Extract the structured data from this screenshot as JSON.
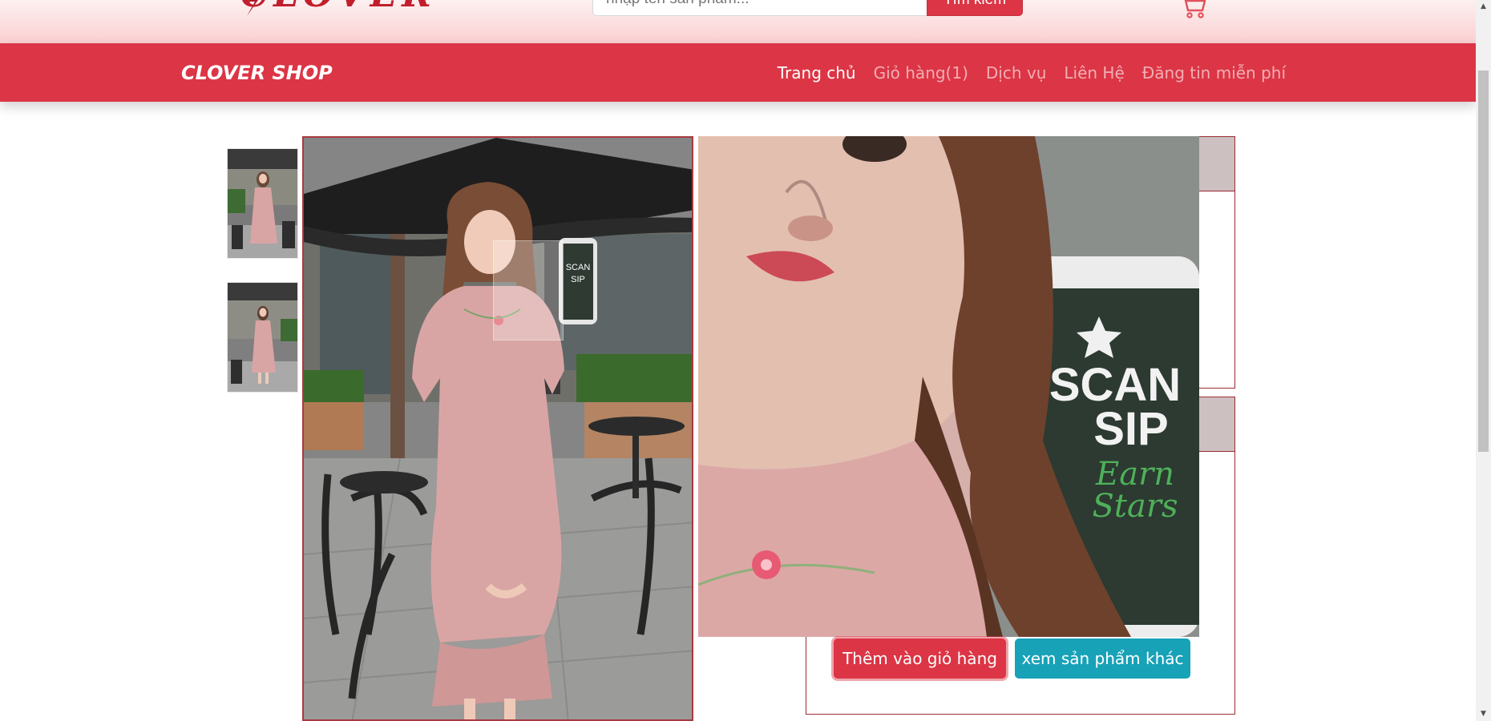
{
  "header": {
    "logo_text": "CLOVER",
    "search": {
      "placeholder": "nhập tên sản phẩm...",
      "button_label": "Tìm kiếm"
    },
    "cart_icon": "shopping-cart-icon"
  },
  "navbar": {
    "brand": "CLOVER SHOP",
    "links": [
      {
        "label": "Trang chủ",
        "active": true
      },
      {
        "label": "Giỏ hàng(1)",
        "active": false
      },
      {
        "label": "Dịch vụ",
        "active": false
      },
      {
        "label": "Liên Hệ",
        "active": false
      },
      {
        "label": "Đăng tin miễn phí",
        "active": false
      }
    ]
  },
  "product": {
    "actions": {
      "add_to_cart": "Thêm vào giỏ hàng",
      "view_more": "xem sản phẩm khác"
    }
  },
  "colors": {
    "primary": "#dc3545",
    "info": "#17a2b8",
    "header_gradient_top": "#fdf0f0",
    "header_gradient_bottom": "#fbd0d2",
    "dress": "#d9a5a4"
  }
}
